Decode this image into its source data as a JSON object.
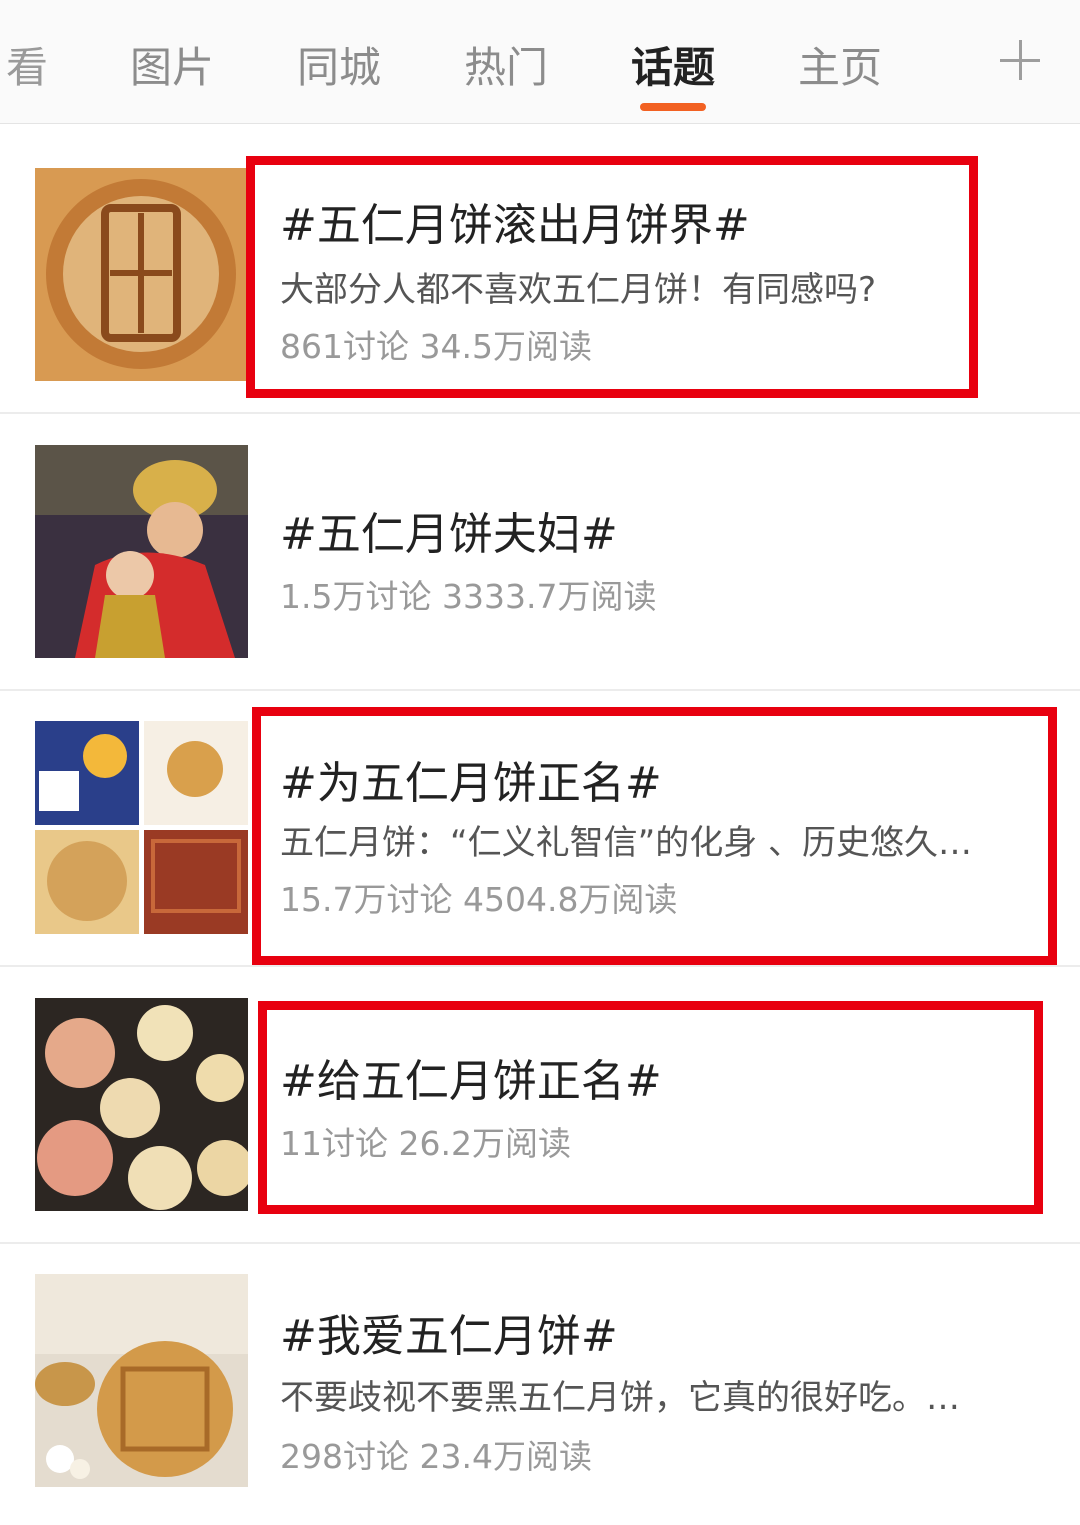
{
  "tabs": {
    "partial_label": "看",
    "items": [
      {
        "label": "图片"
      },
      {
        "label": "同城"
      },
      {
        "label": "热门"
      },
      {
        "label": "话题"
      },
      {
        "label": "主页"
      }
    ],
    "active_index": 3,
    "active_color": "#f26122"
  },
  "topics": [
    {
      "title": "#五仁月饼滚出月饼界#",
      "desc": "大部分人都不喜欢五仁月饼！有同感吗?",
      "stats": "861讨论 34.5万阅读",
      "highlighted": true
    },
    {
      "title": "#五仁月饼夫妇#",
      "desc": "",
      "stats": "1.5万讨论 3333.7万阅读",
      "highlighted": false
    },
    {
      "title": "#为五仁月饼正名#",
      "desc": "五仁月饼：“仁义礼智信”的化身 、历史悠久…",
      "stats": "15.7万讨论 4504.8万阅读",
      "highlighted": true
    },
    {
      "title": "#给五仁月饼正名#",
      "desc": "",
      "stats": "11讨论 26.2万阅读",
      "highlighted": true
    },
    {
      "title": "#我爱五仁月饼#",
      "desc": "不要歧视不要黑五仁月饼，它真的很好吃。…",
      "stats": "298讨论 23.4万阅读",
      "highlighted": false
    }
  ],
  "highlight_color": "#e8000f"
}
